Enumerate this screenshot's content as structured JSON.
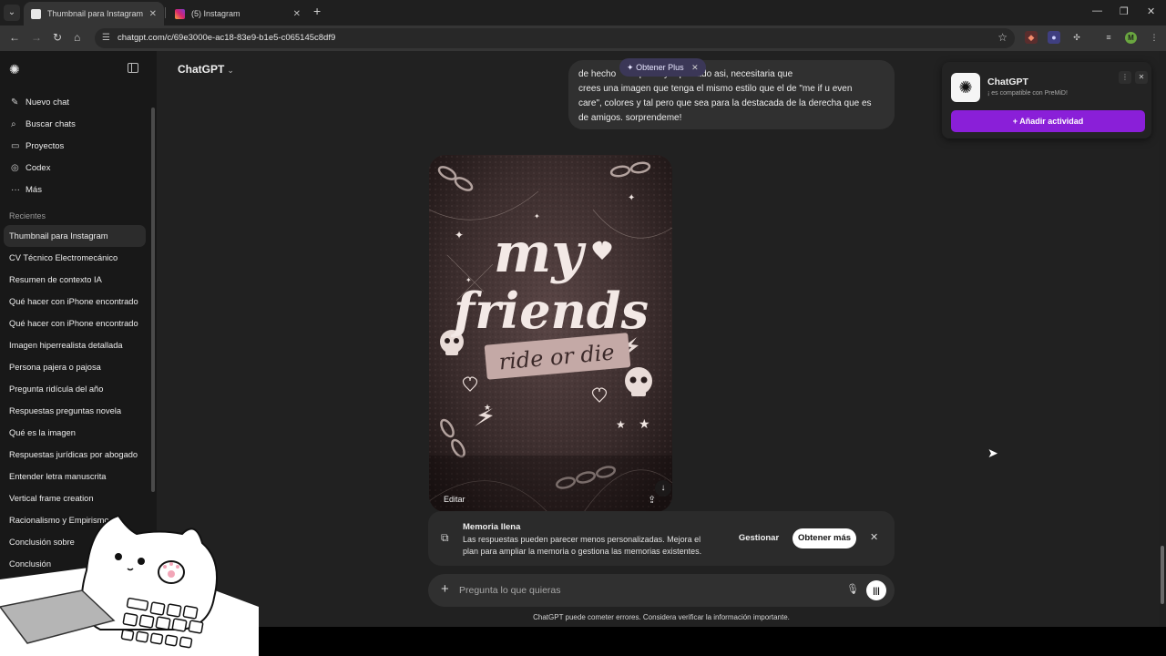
{
  "browser": {
    "tabs": [
      {
        "title": "Thumbnail para Instagram",
        "active": true
      },
      {
        "title": "(5) Instagram",
        "active": false
      }
    ],
    "url": "chatgpt.com/c/69e3000e-ac18-83e9-b1e5-c065145c8df9",
    "profile_initial": "M"
  },
  "sidebar": {
    "nav": [
      {
        "label": "Nuevo chat",
        "icon": "edit-icon"
      },
      {
        "label": "Buscar chats",
        "icon": "search-icon"
      },
      {
        "label": "Proyectos",
        "icon": "folder-icon"
      },
      {
        "label": "Codex",
        "icon": "codex-icon"
      },
      {
        "label": "Más",
        "icon": "more-icon"
      }
    ],
    "section_label": "Recientes",
    "chats": [
      "Thumbnail para Instagram",
      "CV Técnico Electromecánico",
      "Resumen de contexto IA",
      "Qué hacer con iPhone encontrado",
      "Qué hacer con iPhone encontrado",
      "Imagen hiperrealista detallada",
      "Persona pajera o pajosa",
      "Pregunta ridícula del año",
      "Respuestas preguntas novela",
      "Qué es la imagen",
      "Respuestas jurídicas por abogado",
      "Entender letra manuscrita",
      "Vertical frame creation",
      "Racionalismo y Empirismo",
      "Conclusión sobre",
      "Conclusión"
    ]
  },
  "main": {
    "model_title": "ChatGPT",
    "plus_pill": "Obtener Plus",
    "user_message": "de hecho ... que haya quedado asi, necesitaria que crees una imagen que tenga el mismo estilo que el de \"me if u even care\", colores y tal pero que sea para la destacada de la derecha que es de amigos. sorprendeme!",
    "user_message_lines": [
      "de hecho        que haya quedado asi, necesitaria que",
      "crees una imagen que tenga el mismo estilo que el de \"me if u even",
      "care\", colores y tal pero que sea para la destacada de la derecha que es",
      "de amigos. sorprendeme!"
    ],
    "image": {
      "line1": "my",
      "line2": "friends",
      "line3": "ride or die",
      "edit_label": "Editar"
    },
    "memory": {
      "title": "Memoria llena",
      "text": "Las respuestas pueden parecer menos personalizadas. Mejora el plan para ampliar la memoria o gestiona las memorias existentes.",
      "manage_label": "Gestionar",
      "more_label": "Obtener más"
    },
    "composer": {
      "placeholder": "Pregunta lo que quieras"
    },
    "disclaimer": "ChatGPT puede cometer errores. Considera verificar la información importante."
  },
  "premid": {
    "title": "ChatGPT",
    "subtitle": "¡ es compatible con PreMiD!",
    "button_label": "Añadir actividad"
  },
  "colors": {
    "sidebar_bg": "#181818",
    "main_bg": "#212121",
    "bubble_bg": "#303030",
    "premid_accent": "#8a1fd8",
    "poster_text": "#f3e9e6"
  }
}
